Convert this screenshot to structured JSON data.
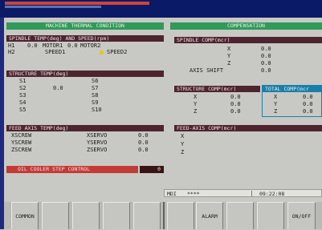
{
  "left_panel": {
    "title": "MACHINE THERMAL CONDITION",
    "spindle": {
      "title": "SPINDLE TEMP(deg) AND SPEED(rpm)",
      "rows": [
        {
          "name": "H1",
          "value": "0.0",
          "label1": "MOTOR1",
          "v1": "0.0",
          "label2": "MOTOR2"
        },
        {
          "name": "H2",
          "label1": "SPEED1",
          "label2": "SPEED2"
        }
      ]
    },
    "structure": {
      "title": "STRUCTURE TEMP(deg)",
      "left": [
        {
          "name": "S1",
          "value": ""
        },
        {
          "name": "S2",
          "value": "0.0"
        },
        {
          "name": "S3",
          "value": ""
        },
        {
          "name": "S4",
          "value": ""
        },
        {
          "name": "S5",
          "value": ""
        }
      ],
      "right": [
        "S6",
        "S7",
        "S8",
        "S9",
        "S10"
      ]
    },
    "feed": {
      "title": "FEED AXIS TEMP(deg)",
      "rows": [
        {
          "screw": "XSCREW",
          "servo": "XSERVO",
          "value": "0.0"
        },
        {
          "screw": "YSCREW",
          "servo": "YSERVO",
          "value": "0.0"
        },
        {
          "screw": "ZSCREW",
          "servo": "ZSERVO",
          "value": "0.0"
        }
      ]
    },
    "oil_cooler": {
      "label": "OIL COOLER STEP CONTROL",
      "value": "0"
    }
  },
  "right_panel": {
    "title": "COMPENSATION",
    "spindle_comp": {
      "title": "SPINDLE COMP(mcr)",
      "rows": [
        {
          "axis": "X",
          "value": "0.0"
        },
        {
          "axis": "Y",
          "value": "0.0"
        },
        {
          "axis": "Z",
          "value": "0.0"
        },
        {
          "axis": "AXIS SHIFT",
          "value": "0.0"
        }
      ]
    },
    "structure_comp": {
      "title": "STRUCTURE COMP(mcr)",
      "rows": [
        {
          "axis": "X",
          "value": "0.0"
        },
        {
          "axis": "Y",
          "value": "0.0"
        },
        {
          "axis": "Z",
          "value": "0.0"
        }
      ]
    },
    "total_comp": {
      "title": "TOTAL COMP(mcr",
      "rows": [
        {
          "axis": "X",
          "value": "0.0"
        },
        {
          "axis": "Y",
          "value": "0.0"
        },
        {
          "axis": "Z",
          "value": "0.0"
        }
      ]
    },
    "feed_comp": {
      "title": "FEED-AXIS COMP(mcr)",
      "axes": [
        "X",
        "Y",
        "Z"
      ]
    }
  },
  "status_bar": {
    "mode": "MDI",
    "stars": "****",
    "time": "09:22:08"
  },
  "softkeys": {
    "common": "COMMON",
    "alarm": "ALARM",
    "onoff": "ON/OFF"
  },
  "colors": {
    "panel_title": "#2f9a5a",
    "section_title": "#4d2430",
    "alert": "#c43a36",
    "total_comp": "#1a7fa8",
    "background": "#c8c9c4"
  }
}
